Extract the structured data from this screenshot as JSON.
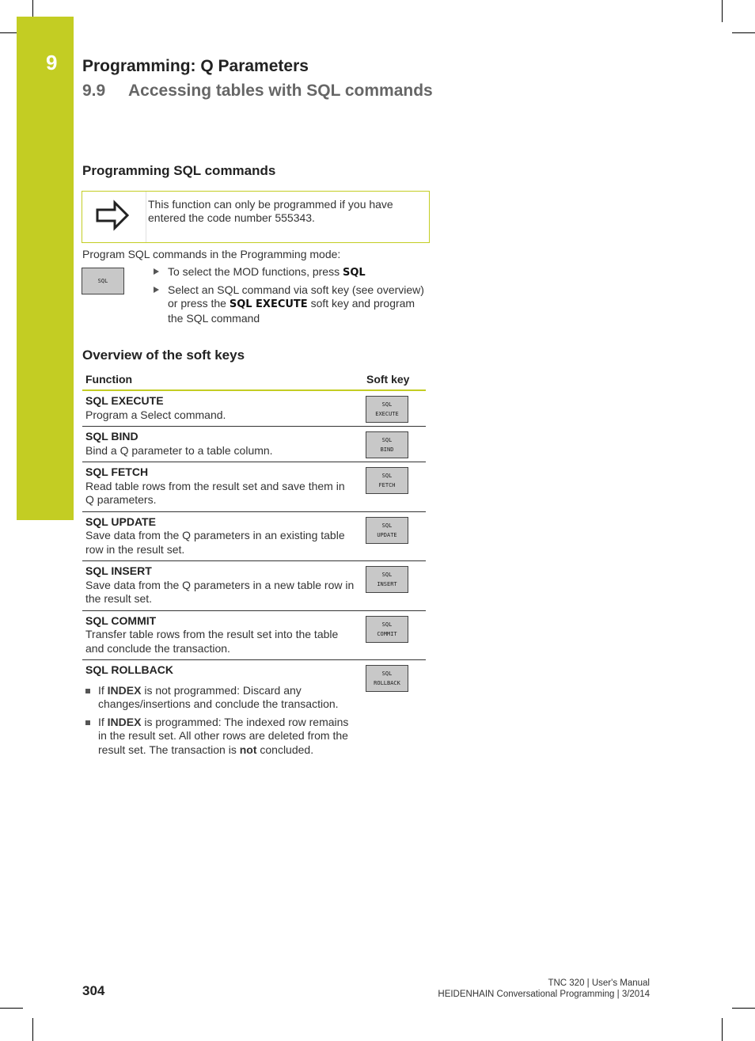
{
  "header": {
    "chapter_number": "9",
    "chapter_title": "Programming: Q Parameters",
    "section_number": "9.9",
    "section_title": "Accessing tables with SQL commands"
  },
  "programming": {
    "heading": "Programming SQL commands",
    "note_icon": "right-arrow-icon",
    "note_text": "This function can only be programmed if you have entered the code number 555343.",
    "intro": "Program SQL commands in the Programming mode:",
    "softkey": [
      "SQL"
    ],
    "steps": [
      {
        "pre": "To select the MOD functions, press ",
        "kw": "SQL",
        "post": ""
      },
      {
        "pre": "Select an SQL command via soft key (see overview) or press the ",
        "kw": "SQL EXECUTE",
        "post": " soft key and program the SQL command"
      }
    ]
  },
  "overview": {
    "heading": "Overview of the soft keys",
    "col_function": "Function",
    "col_softkey": "Soft key",
    "rows": [
      {
        "name": "SQL EXECUTE",
        "desc": "Program a Select command.",
        "key1": "SQL",
        "key2": "EXECUTE"
      },
      {
        "name": "SQL BIND",
        "desc": "Bind a Q parameter to a table column.",
        "key1": "SQL",
        "key2": "BIND"
      },
      {
        "name": "SQL FETCH",
        "desc": "Read table rows from the result set and save them in Q parameters.",
        "key1": "SQL",
        "key2": "FETCH"
      },
      {
        "name": "SQL UPDATE",
        "desc": "Save data from the Q parameters in an existing table row in the result set.",
        "key1": "SQL",
        "key2": "UPDATE"
      },
      {
        "name": "SQL INSERT",
        "desc": "Save data from the Q parameters in a new table row in the result set.",
        "key1": "SQL",
        "key2": "INSERT"
      },
      {
        "name": "SQL COMMIT",
        "desc": "Transfer table rows from the result set into the table and conclude the transaction.",
        "key1": "SQL",
        "key2": "COMMIT"
      }
    ],
    "rollback": {
      "name": "SQL ROLLBACK",
      "key1": "SQL",
      "key2": "ROLLBACK",
      "bullets": [
        {
          "pre": "If ",
          "kw": "INDEX",
          "post": " is not programmed: Discard any changes/insertions and conclude the transaction."
        },
        {
          "pre": "If ",
          "kw": "INDEX",
          "post": " is programmed: The indexed row remains in the result set. All other rows are deleted from the result set. The transaction is ",
          "kw2": "not",
          "post2": " concluded."
        }
      ]
    }
  },
  "footer": {
    "page_number": "304",
    "line1": "TNC 320 | User's Manual",
    "line2": "HEIDENHAIN Conversational Programming | 3/2014"
  },
  "colors": {
    "accent": "#c3cd23"
  }
}
